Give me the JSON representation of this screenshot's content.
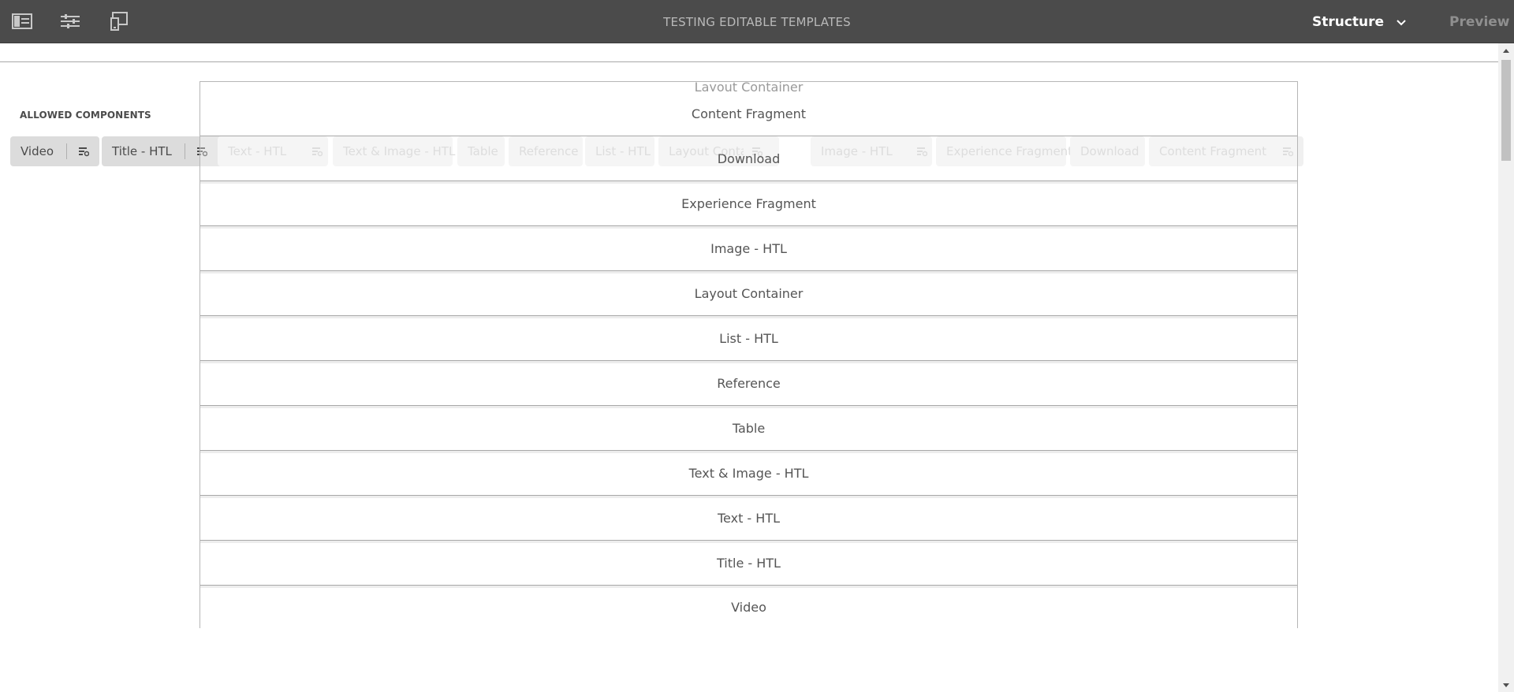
{
  "toolbar": {
    "icons": [
      "side-panel-icon",
      "page-information-icon",
      "emulator-icon"
    ],
    "title": "TESTING EDITABLE TEMPLATES",
    "mode_label": "Structure",
    "preview_label": "Preview"
  },
  "allowed_components": {
    "heading": "ALLOWED COMPONENTS",
    "chips": [
      {
        "label": "Video",
        "state": "active"
      },
      {
        "label": "Title - HTL",
        "state": "active"
      },
      {
        "label": "Text - HTL",
        "state": "faded"
      },
      {
        "label": "Text & Image - HTL",
        "state": "faded"
      },
      {
        "label": "Table",
        "state": "faded"
      },
      {
        "label": "Reference",
        "state": "faded"
      },
      {
        "label": "List - HTL",
        "state": "faded"
      },
      {
        "label": "Layout Container",
        "state": "faded"
      },
      {
        "label": "Image - HTL",
        "state": "faded"
      },
      {
        "label": "Experience Fragment",
        "state": "faded"
      },
      {
        "label": "Download",
        "state": "faded"
      },
      {
        "label": "Content Fragment",
        "state": "faded"
      }
    ]
  },
  "component_list": {
    "ghost_label": "Layout Container",
    "items": [
      "Content Fragment",
      "Download",
      "Experience Fragment",
      "Image - HTL",
      "Layout Container",
      "List - HTL",
      "Reference",
      "Table",
      "Text & Image - HTL",
      "Text - HTL",
      "Title - HTL",
      "Video"
    ]
  },
  "colors": {
    "topbar": "#4b4b4b",
    "chip_active": "#dcdcdc",
    "chip_faded": "#f0f0f0"
  }
}
